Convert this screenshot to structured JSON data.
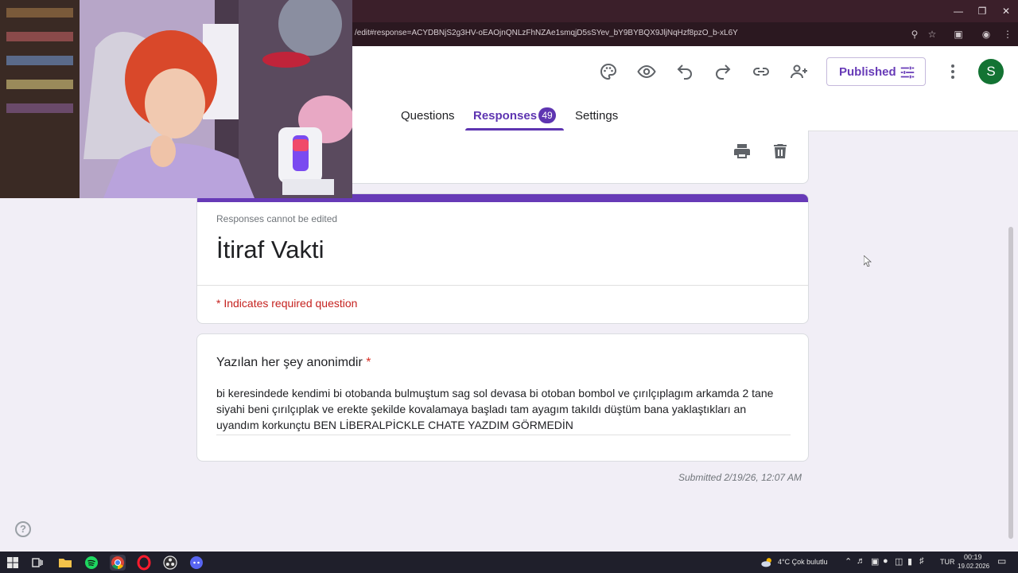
{
  "browser": {
    "url": "/edit#response=ACYDBNjS2g3HV-oEAOjnQNLzFhNZAe1smqjD5sSYev_bY9BYBQX9JljNqHzf8pzO_b-xL6Y"
  },
  "header": {
    "published_label": "Published",
    "avatar_letter": "S",
    "tabs": [
      {
        "label": "Questions"
      },
      {
        "label": "Responses",
        "count": "49"
      },
      {
        "label": "Settings"
      }
    ]
  },
  "form": {
    "no_edit_note": "Responses cannot be edited",
    "title": "İtiraf Vakti",
    "required_note": "* Indicates required question",
    "question": {
      "label": "Yazılan her şey anonimdir",
      "required_mark": "*",
      "answer": "bi keresindede kendimi bi otobanda bulmuştum sag sol devasa bi otoban bombol ve çırılçıplagım arkamda 2 tane siyahi beni çırılçıplak ve erekte şekilde kovalamaya başladı tam ayagım takıldı düştüm bana yaklaştıkları an uyandım korkunçtu BEN LİBERALPİCKLE CHATE YAZDIM GÖRMEDİN"
    },
    "submitted": "Submitted 2/19/26, 12:07 AM"
  },
  "help_label": "?",
  "taskbar": {
    "weather": "4°C  Çok bulutlu",
    "lang": "TUR",
    "time": "00:19",
    "date": "19.02.2026"
  },
  "colors": {
    "accent": "#673ab7",
    "required": "#c5221f",
    "avatar": "#137333"
  }
}
